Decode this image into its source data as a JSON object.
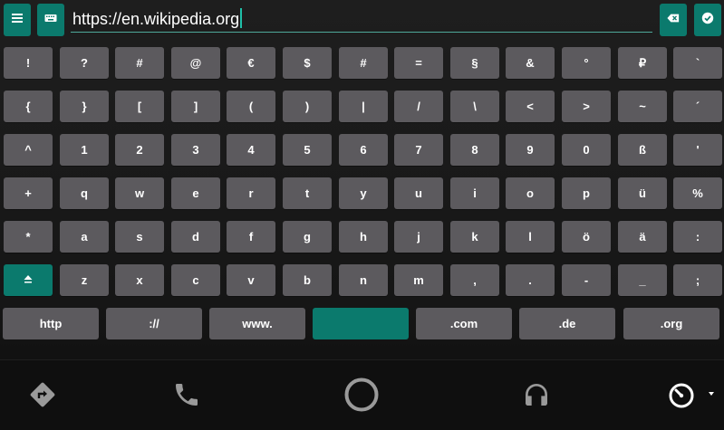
{
  "top_bar": {
    "menu_icon": "menu-icon",
    "keyboard_icon": "keyboard-icon",
    "url_value": "https://en.wikipedia.org",
    "backspace_icon": "backspace-icon",
    "confirm_icon": "check-circle-icon"
  },
  "keyboard": {
    "rows": [
      [
        "!",
        "?",
        "#",
        "@",
        "€",
        "$",
        "#",
        "=",
        "§",
        "&",
        "°",
        "₽",
        "`"
      ],
      [
        "{",
        "}",
        "[",
        "]",
        "(",
        ")",
        "|",
        "/",
        "\\",
        "<",
        ">",
        "~",
        "´"
      ],
      [
        "^",
        "1",
        "2",
        "3",
        "4",
        "5",
        "6",
        "7",
        "8",
        "9",
        "0",
        "ß",
        "'"
      ],
      [
        "+",
        "q",
        "w",
        "e",
        "r",
        "t",
        "y",
        "u",
        "i",
        "o",
        "p",
        "ü",
        "%"
      ],
      [
        "*",
        "a",
        "s",
        "d",
        "f",
        "g",
        "h",
        "j",
        "k",
        "l",
        "ö",
        "ä",
        ":"
      ],
      [
        "",
        "z",
        "x",
        "c",
        "v",
        "b",
        "n",
        "m",
        ",",
        ".",
        "-",
        "_",
        ";"
      ]
    ],
    "shift_icon": "shift-icon",
    "bottom_row": [
      "http",
      "://",
      "www.",
      "",
      ".com",
      ".de",
      ".org"
    ],
    "space_key": "space-key"
  },
  "colors": {
    "accent": "#0b7a6d",
    "key": "#5c5a5e"
  },
  "navbar": {
    "icons": [
      "directions-icon",
      "phone-icon",
      "home-circle-icon",
      "headphones-icon",
      "speedometer-icon"
    ]
  }
}
